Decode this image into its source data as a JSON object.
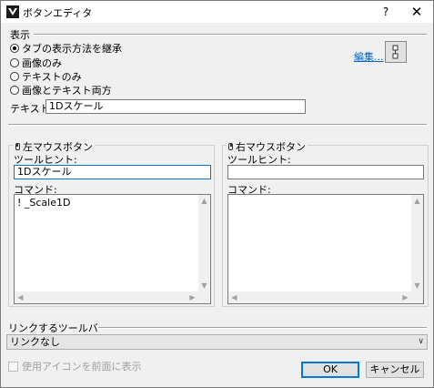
{
  "window": {
    "title": "ボタンエディタ",
    "help_label": "?",
    "close_label": "✕"
  },
  "display": {
    "section_label": "表示",
    "radios": [
      {
        "label": "タブの表示方法を継承",
        "checked": true
      },
      {
        "label": "画像のみ",
        "checked": false
      },
      {
        "label": "テキストのみ",
        "checked": false
      },
      {
        "label": "画像とテキスト両方",
        "checked": false
      }
    ],
    "edit_link": "編集...",
    "text_label": "テキスト:",
    "text_value": "1Dスケール"
  },
  "left_button": {
    "group_title": "左マウスボタン",
    "tooltip_label": "ツールヒント:",
    "tooltip_value": "1Dスケール",
    "command_label": "コマンド:",
    "command_value": "! _Scale1D"
  },
  "right_button": {
    "group_title": "右マウスボタン",
    "tooltip_label": "ツールヒント:",
    "tooltip_value": "",
    "command_label": "コマンド:",
    "command_value": ""
  },
  "toolbar_link": {
    "section_label": "リンクするツールバー",
    "selected": "リンクなし"
  },
  "use_icon_label": "使用アイコンを前面に表示",
  "buttons": {
    "ok": "OK",
    "cancel": "キャンセル"
  }
}
